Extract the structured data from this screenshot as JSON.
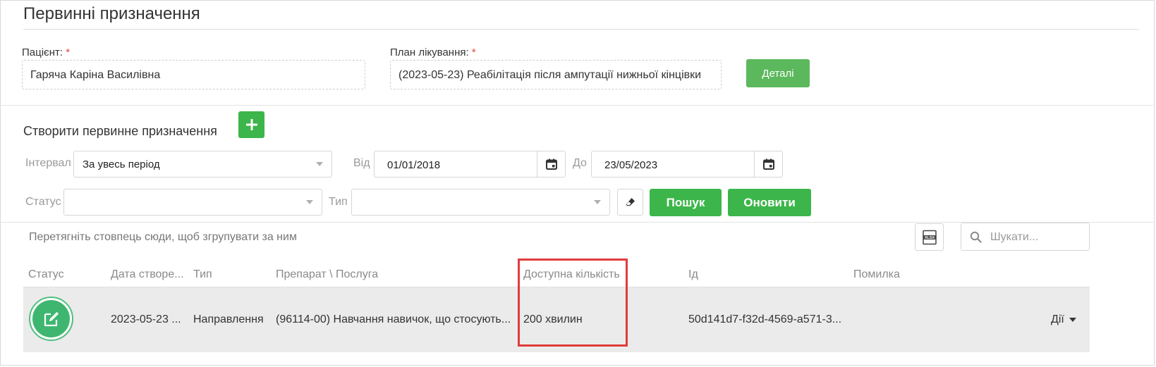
{
  "page": {
    "title": "Первинні призначення"
  },
  "patient": {
    "label": "Пацієнт:",
    "required_mark": "*",
    "value": "Гаряча Каріна Василівна"
  },
  "plan": {
    "label": "План лікування:",
    "required_mark": "*",
    "value": "(2023-05-23) Реабілітація після ампутації нижньої кінцівки"
  },
  "details_button": "Деталі",
  "create": {
    "title": "Створити первинне призначення",
    "add_icon": "plus-icon"
  },
  "filters": {
    "interval_label": "Інтервал",
    "interval_value": "За увесь період",
    "from_label": "Від",
    "from_value": "01/01/2018",
    "to_label": "До",
    "to_value": "23/05/2023",
    "status_label": "Статус",
    "status_value": "",
    "type_label": "Тип",
    "type_value": "",
    "search_button": "Пошук",
    "refresh_button": "Оновити"
  },
  "grid": {
    "group_hint": "Перетягніть стовпець сюди, щоб згрупувати за ним",
    "export_icon": "xlsx-export-icon",
    "search_placeholder": "Шукати...",
    "columns": [
      "Статус",
      "Дата створе...",
      "Тип",
      "Препарат \\ Послуга",
      "Доступна кількість",
      "Ід",
      "Помилка"
    ],
    "rows": [
      {
        "status_icon": "edit-icon",
        "date": "2023-05-23 ...",
        "type": "Направлення",
        "service": "(96114-00) Навчання навичок, що стосують...",
        "available": "200 хвилин",
        "id": "50d141d7-f32d-4569-a571-3...",
        "error": "",
        "actions": "Дії"
      }
    ]
  },
  "colors": {
    "accent_green": "#5cb85c",
    "button_green": "#3cb64a",
    "highlight_red": "#e03c3c"
  }
}
